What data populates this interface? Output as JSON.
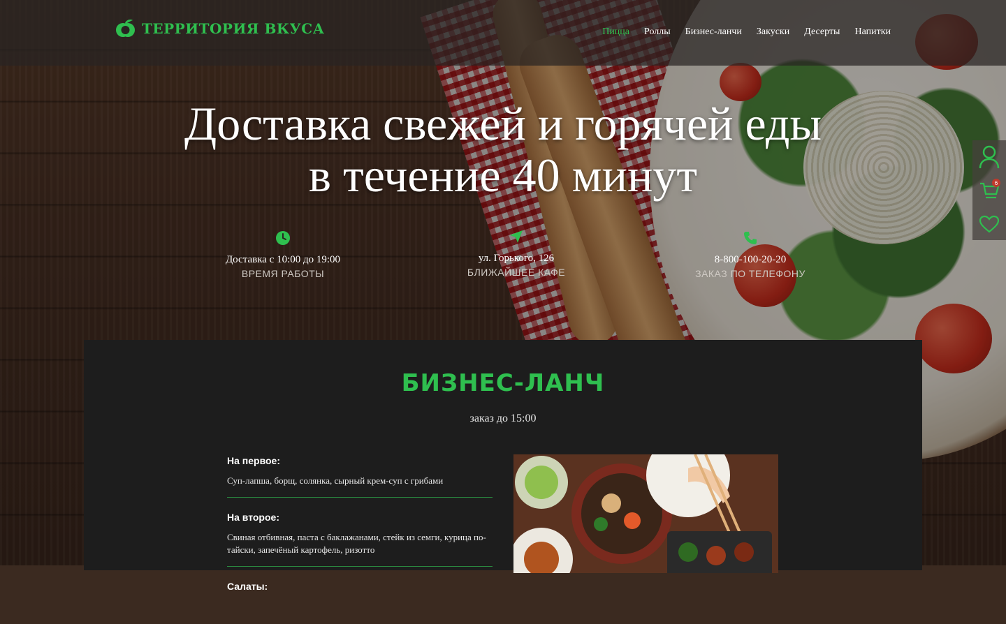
{
  "brand": {
    "name": "ТЕРРИТОРИЯ ВКУСА",
    "accent": "#2fbf4f"
  },
  "nav": {
    "items": [
      {
        "label": "Пицца",
        "active": true
      },
      {
        "label": "Роллы"
      },
      {
        "label": "Бизнес-ланчи"
      },
      {
        "label": "Закуски"
      },
      {
        "label": "Десерты"
      },
      {
        "label": "Напитки"
      }
    ]
  },
  "hero": {
    "title_line1": "Доставка свежей и горячей еды",
    "title_line2": "в течение  40 минут"
  },
  "info": [
    {
      "icon": "clock-icon",
      "value": "Доставка с 10:00 до 19:00",
      "label": "ВРЕМЯ РАБОТЫ"
    },
    {
      "icon": "location-arrow-icon",
      "value": "ул. Горького, 126",
      "label": "БЛИЖАЙШЕЕ КАФЕ"
    },
    {
      "icon": "phone-icon",
      "value": "8-800-100-20-20",
      "label": "ЗАКАЗ ПО  ТЕЛЕФОНУ"
    }
  ],
  "side": {
    "cart_count": "6"
  },
  "lunch": {
    "title": "БИЗНЕС-ЛАНЧ",
    "subtitle": "заказ до 15:00",
    "courses": [
      {
        "title": "На первое:",
        "text": "Суп-лапша, борщ, солянка, сырный крем-суп с грибами"
      },
      {
        "title": "На второе:",
        "text": "Свиная  отбивная, паста с баклажанами,  стейк из семги, курица по-тайски, запечёный картофель, ризотто"
      },
      {
        "title": "Салаты:",
        "text": ""
      }
    ]
  }
}
